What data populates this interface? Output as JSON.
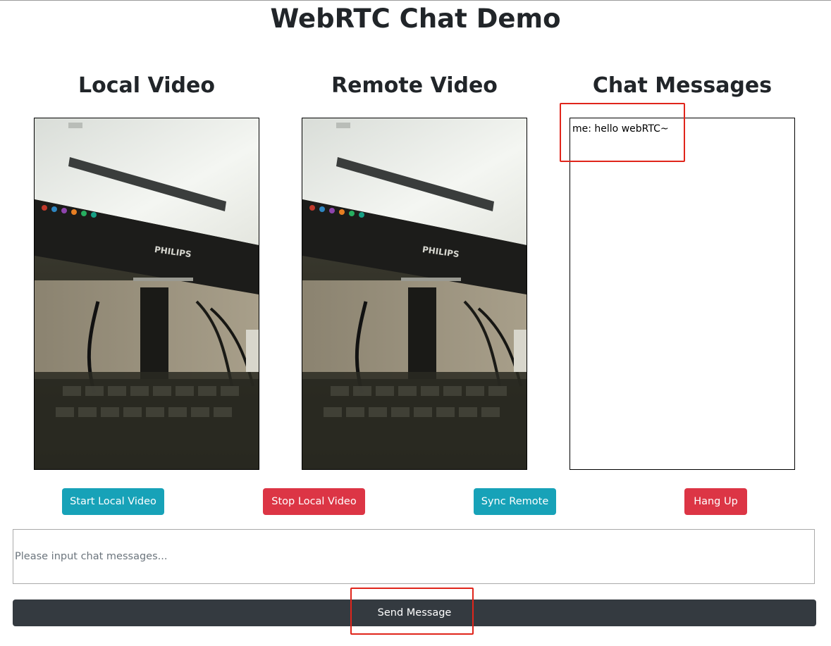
{
  "page": {
    "title": "WebRTC Chat Demo"
  },
  "columns": {
    "local_video": "Local Video",
    "remote_video": "Remote Video",
    "chat_messages": "Chat Messages"
  },
  "chat": {
    "messages": [
      {
        "text": "me: hello webRTC~"
      }
    ],
    "input_placeholder": "Please input chat messages...",
    "input_value": ""
  },
  "buttons": {
    "start_local": "Start Local Video",
    "stop_local": "Stop Local Video",
    "sync_remote": "Sync Remote",
    "hang_up": "Hang Up",
    "send_message": "Send Message"
  },
  "video_frame": {
    "monitor_brand": "PHILIPS"
  },
  "colors": {
    "info": "#17a2b8",
    "danger": "#dc3545",
    "dark": "#343a40",
    "highlight": "#e0251b"
  }
}
